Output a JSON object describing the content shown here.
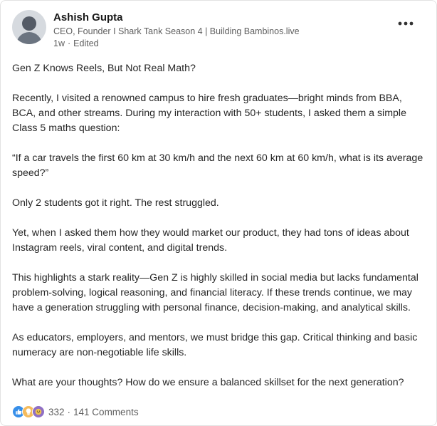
{
  "author": {
    "name": "Ashish Gupta",
    "headline": "CEO, Founder I Shark Tank Season 4 | Building Bambinos.live",
    "time": "1w",
    "separator": "·",
    "edited": "Edited"
  },
  "post": {
    "paragraphs": [
      "Gen Z Knows Reels, But Not Real Math?",
      "Recently, I visited a renowned campus to hire fresh graduates—bright minds from BBA, BCA, and other streams. During my interaction with 50+ students, I asked them a simple Class 5 maths question:",
      "“If a car travels the first 60 km at 30 km/h and the next 60 km at 60 km/h, what is its average speed?”",
      "Only 2 students got it right. The rest struggled.",
      "Yet, when I asked them how they would market our product, they had tons of ideas about Instagram reels, viral content, and digital trends.",
      "This highlights a stark reality—Gen Z is highly skilled in social media but lacks fundamental problem-solving, logical reasoning, and financial literacy. If these trends continue, we may have a generation struggling with personal finance, decision-making, and analytical skills.",
      "As educators, employers, and mentors, we must bridge this gap. Critical thinking and basic numeracy are non-negotiable life skills.",
      "What are your thoughts? How do we ensure a balanced skillset for the next generation?"
    ]
  },
  "social": {
    "reaction_icons": [
      "like-reaction-icon",
      "insightful-reaction-icon",
      "funny-reaction-icon"
    ],
    "reactions_count": "332",
    "separator": "·",
    "comments": "141 Comments"
  },
  "colors": {
    "like": "#378fe9",
    "insightful": "#f5bb5c",
    "funny": "#8f6fc4",
    "text": "#262626",
    "muted": "#5e5e5e"
  }
}
